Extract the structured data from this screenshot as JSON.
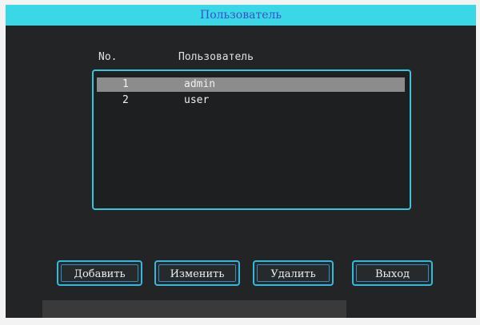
{
  "window": {
    "title": "Пользователь"
  },
  "table": {
    "headers": {
      "no": "No.",
      "user": "Пользователь"
    },
    "rows": [
      {
        "no": "1",
        "user": "admin",
        "selected": true
      },
      {
        "no": "2",
        "user": "user",
        "selected": false
      }
    ]
  },
  "buttons": {
    "add": "Добавить",
    "edit": "Изменить",
    "delete": "Удалить",
    "exit": "Выход"
  },
  "colors": {
    "title_bar": "#3ad8e6",
    "title_text": "#3b4fc8",
    "accent_border": "#36c6d8",
    "selection": "#8c8c8c",
    "background": "#222426"
  }
}
